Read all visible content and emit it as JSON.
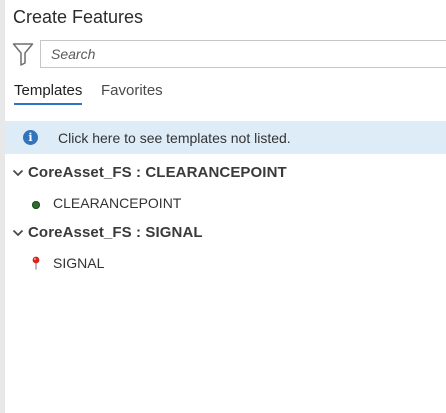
{
  "panel": {
    "title": "Create Features"
  },
  "search": {
    "placeholder": "Search",
    "value": ""
  },
  "tabs": [
    {
      "label": "Templates",
      "active": true
    },
    {
      "label": "Favorites",
      "active": false
    }
  ],
  "info_bar": {
    "text": "Click here to see templates not listed.",
    "icon": "info-icon"
  },
  "groups": [
    {
      "label": "CoreAsset_FS : CLEARANCEPOINT",
      "expanded": true,
      "icon": "chevron-down-icon",
      "templates": [
        {
          "label": "CLEARANCEPOINT",
          "icon": "green-point-symbol-icon",
          "color": "#2f6b2f"
        }
      ]
    },
    {
      "label": "CoreAsset_FS : SIGNAL",
      "expanded": true,
      "icon": "chevron-down-icon",
      "templates": [
        {
          "label": "SIGNAL",
          "icon": "red-pin-symbol-icon",
          "color": "#d7261e"
        }
      ]
    }
  ],
  "colors": {
    "accent": "#2d74c4",
    "info_background": "#deecf7",
    "info_icon": "#2f74bd"
  }
}
